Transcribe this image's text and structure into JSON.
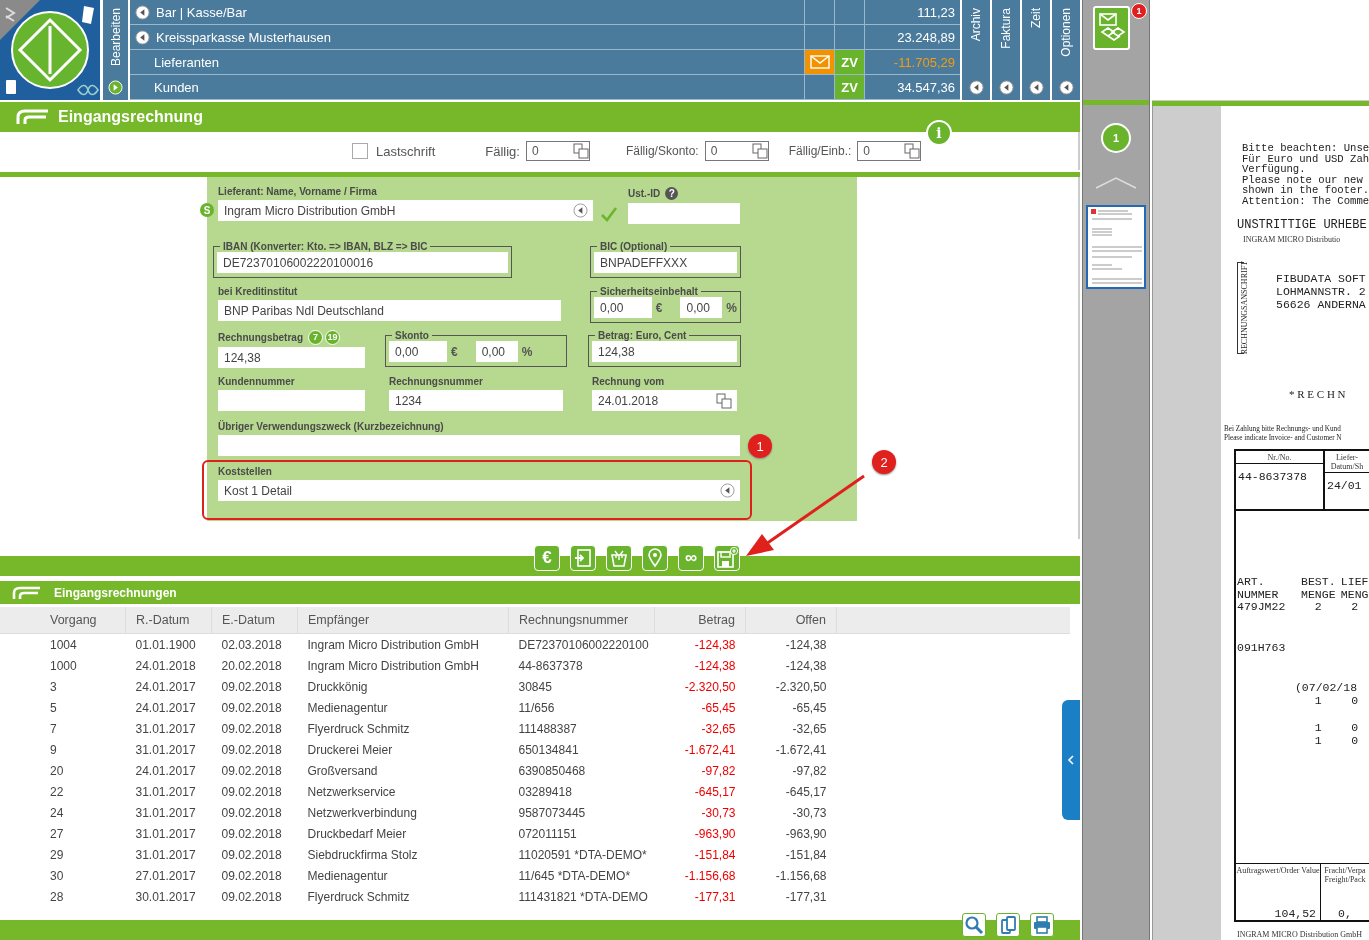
{
  "header": {
    "side_label": "Bearbeiten",
    "accounts": [
      {
        "label": "Bar | Kasse/Bar",
        "has_arrow": true,
        "mail": false,
        "amount": "111,23",
        "negative": false
      },
      {
        "label": "Kreissparkasse Musterhausen",
        "has_arrow": true,
        "mail": false,
        "amount": "23.248,89",
        "negative": false
      },
      {
        "label": "Lieferanten",
        "has_arrow": false,
        "mail": true,
        "zv": "ZV",
        "amount": "-11.705,29",
        "negative": true
      },
      {
        "label": "Kunden",
        "has_arrow": false,
        "mail": false,
        "zv": "ZV",
        "amount": "34.547,36",
        "negative": false
      }
    ],
    "tabs": [
      "Archiv",
      "Faktura",
      "Zeit",
      "Optionen"
    ]
  },
  "title": "Eingangsrechnung",
  "filters": {
    "lastschrift": {
      "label": "Lastschrift",
      "checked": false
    },
    "info": "i",
    "dates": [
      {
        "label": "Fällig:",
        "value": "0"
      },
      {
        "label": "Fällig/Skonto:",
        "value": "0"
      },
      {
        "label": "Fällig/Einb.:",
        "value": "0"
      }
    ]
  },
  "form": {
    "supplier": {
      "label": "Lieferant: Name, Vorname / Firma",
      "value": "Ingram Micro Distribution GmbH",
      "badge": "S",
      "verified": true
    },
    "ust_id": {
      "label": "Ust.-ID",
      "help": "?"
    },
    "iban": {
      "label": "IBAN (Konverter: Kto. => IBAN, BLZ => BIC",
      "value": "DE72370106002220100016"
    },
    "bic": {
      "label": "BIC (Optional)",
      "value": "BNPADEFFXXX"
    },
    "bank": {
      "label": "bei Kreditinstitut",
      "value": "BNP Paribas Ndl Deutschland"
    },
    "retention": {
      "label": "Sicherheitseinbehalt",
      "amount": "0,00",
      "currency": "€",
      "percent": "0,00",
      "percent_sign": "%"
    },
    "amount": {
      "label": "Rechnungsbetrag",
      "tax_rates": [
        "7",
        "19"
      ],
      "value": "124,38"
    },
    "skonto": {
      "label": "Skonto",
      "amount": "0,00",
      "currency": "€",
      "percent": "0,00",
      "percent_sign": "%"
    },
    "euro_cent": {
      "label": "Betrag: Euro, Cent",
      "value": "124,38"
    },
    "customer_no": {
      "label": "Kundennummer"
    },
    "invoice_no": {
      "label": "Rechnungsnummer",
      "value": "1234"
    },
    "invoice_date": {
      "label": "Rechnung vom",
      "value": "24.01.2018"
    },
    "purpose": {
      "label": "Übriger Verwendungszweck (Kurzbezeichnung)"
    },
    "cost_centers": {
      "label": "Koststellen",
      "value": "Kost 1 Detail"
    }
  },
  "annotations": [
    "1",
    "2"
  ],
  "toolbar": [
    {
      "kind": "glyph",
      "text": "€"
    },
    {
      "kind": "transfer"
    },
    {
      "kind": "basket"
    },
    {
      "kind": "pin"
    },
    {
      "kind": "glyph",
      "text": "∞"
    },
    {
      "kind": "save"
    }
  ],
  "list": {
    "title": "Eingangsrechnungen",
    "columns": [
      "Vorgang",
      "R.-Datum",
      "E.-Datum",
      "Empfänger",
      "Rechnungsnummer",
      "Betrag",
      "Offen"
    ],
    "rows": [
      [
        "1004",
        "01.01.1900",
        "02.03.2018",
        "Ingram Micro Distribution GmbH",
        "DE72370106002220100",
        "-124,38",
        "-124,38"
      ],
      [
        "1000",
        "24.01.2018",
        "20.02.2018",
        "Ingram Micro Distribution GmbH",
        "44-8637378",
        "-124,38",
        "-124,38"
      ],
      [
        "3",
        "24.01.2017",
        "09.02.2018",
        "Druckkönig",
        "30845",
        "-2.320,50",
        "-2.320,50"
      ],
      [
        "5",
        "24.01.2017",
        "09.02.2018",
        "Medienagentur",
        "11/656",
        "-65,45",
        "-65,45"
      ],
      [
        "7",
        "31.01.2017",
        "09.02.2018",
        "Flyerdruck Schmitz",
        "111488387",
        "-32,65",
        "-32,65"
      ],
      [
        "9",
        "31.01.2017",
        "09.02.2018",
        "Druckerei Meier",
        "650134841",
        "-1.672,41",
        "-1.672,41"
      ],
      [
        "20",
        "24.01.2017",
        "09.02.2018",
        "Großversand",
        "6390850468",
        "-97,82",
        "-97,82"
      ],
      [
        "22",
        "31.01.2017",
        "09.02.2018",
        "Netzwerkservice",
        "03289418",
        "-645,17",
        "-645,17"
      ],
      [
        "24",
        "31.01.2017",
        "09.02.2018",
        "Netzwerkverbindung",
        "9587073445",
        "-30,73",
        "-30,73"
      ],
      [
        "27",
        "31.01.2017",
        "09.02.2018",
        "Druckbedarf Meier",
        "072011151",
        "-963,90",
        "-963,90"
      ],
      [
        "29",
        "31.01.2017",
        "09.02.2018",
        "Siebdruckfirma Stolz",
        "11020591 *DTA-DEMO*",
        "-151,84",
        "-151,84"
      ],
      [
        "30",
        "27.01.2017",
        "09.02.2018",
        "Medienagentur",
        "11/645 *DTA-DEMO*",
        "-1.156,68",
        "-1.156,68"
      ],
      [
        "28",
        "30.01.2017",
        "09.02.2018",
        "Flyerdruck Schmitz",
        "111431821 *DTA-DEMO",
        "-177,31",
        "-177,31"
      ]
    ]
  },
  "preview": {
    "notification_count": "1",
    "page_number": "1"
  },
  "document": {
    "notice": [
      "Bitte beachten: Unse",
      "Für Euro und USD Zah",
      "Verfügung.",
      "Please note our new",
      "shown in the footer.",
      "Attention: The Comme"
    ],
    "heading": "UNSTRITTIGE URHEBE",
    "sender": "INGRAM MICRO Distributio",
    "address_label": "RECHNUNGSANSCHRIFT",
    "address": [
      "FIBUDATA SOFT",
      "LOHMANNSTR. 2",
      "56626 ANDERNA"
    ],
    "title": "* R E C H N",
    "payment_note": [
      "Bei Zahlung bitte Rechnungs- und Kund",
      "Please indicate Invoice- and Customer N"
    ],
    "ref_headers": [
      "Nr./No.",
      "Liefer-Datum/Sh"
    ],
    "ref_values": [
      "44-8637378",
      "24/01"
    ],
    "item_groups": [
      [
        {
          "art": "ART.",
          "best": "BEST.",
          "lief": "LIEF"
        },
        {
          "art": "NUMMER",
          "best": "MENGE",
          "lief": "MENG"
        },
        {
          "art": "479JM22",
          "best": "2",
          "lief": "2"
        }
      ],
      [
        {
          "art": "091H763"
        }
      ],
      [
        {
          "best": "(07/02/18"
        },
        {
          "best": "1",
          "lief": "0"
        }
      ],
      [
        {
          "best": "1",
          "lief": "0"
        },
        {
          "best": "1",
          "lief": "0"
        }
      ]
    ],
    "total_headers": [
      "Auftragswert/Order Value",
      "Fracht/Verpa",
      "Freight/Pack"
    ],
    "total_values": [
      "104,52",
      "0,"
    ],
    "footer": "INGRAM MICRO Distribution GmbH"
  }
}
